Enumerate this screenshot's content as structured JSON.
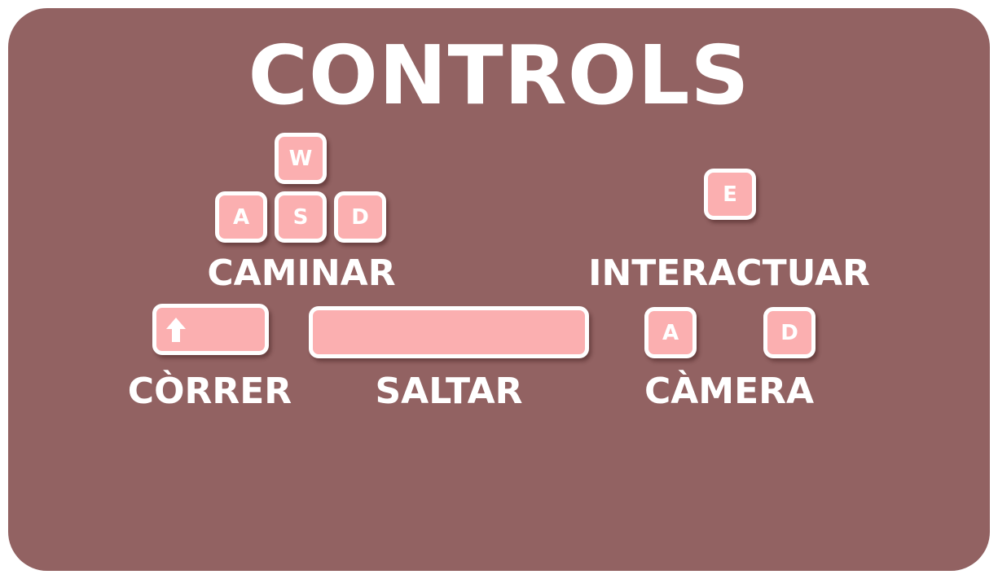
{
  "title": "CONTROLS",
  "colors": {
    "panel": "#926262",
    "key_fill": "#fbafb0",
    "key_border": "#ffffff",
    "text": "#ffffff"
  },
  "groups": {
    "walk": {
      "label": "CAMINAR",
      "keys": {
        "up": "W",
        "left": "A",
        "down": "S",
        "right": "D"
      }
    },
    "interact": {
      "label": "INTERACTUAR",
      "key": "E"
    },
    "run": {
      "label": "CÒRRER",
      "key_icon": "shift-arrow-up-icon"
    },
    "jump": {
      "label": "SALTAR",
      "key_icon": "spacebar"
    },
    "camera": {
      "label": "CÀMERA",
      "keys": {
        "left": "A",
        "right": "D"
      }
    }
  }
}
